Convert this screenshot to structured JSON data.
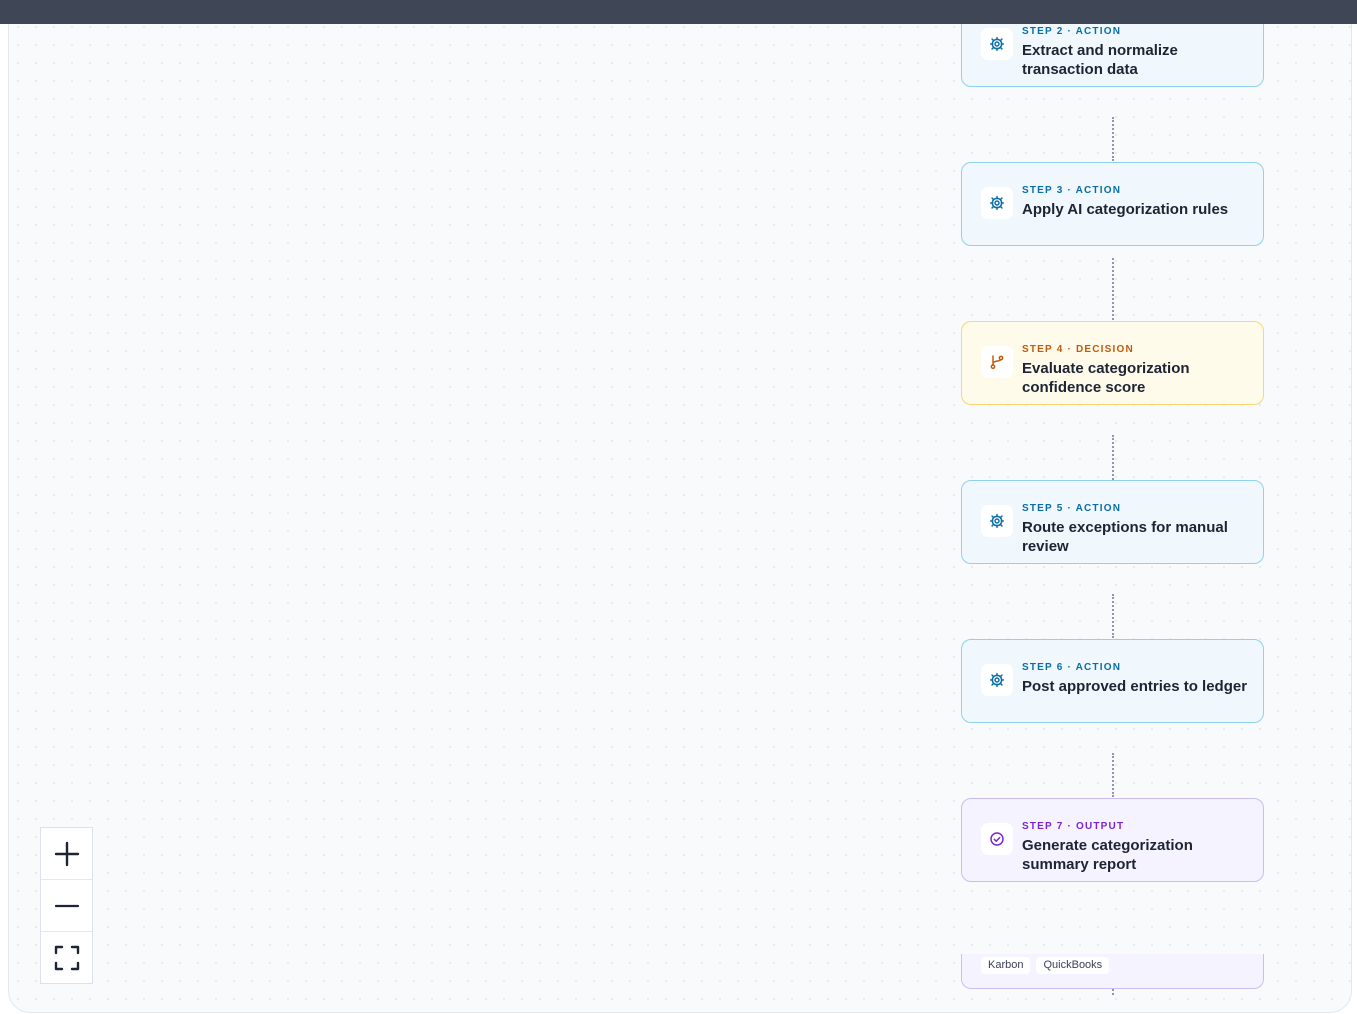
{
  "canvas": {
    "steps": [
      {
        "label": "STEP 2 · ACTION",
        "title": "Extract and normalize transaction data",
        "kind": "action",
        "icon": "gear-icon"
      },
      {
        "label": "STEP 3 · ACTION",
        "title": "Apply AI categorization rules",
        "kind": "action",
        "icon": "gear-icon"
      },
      {
        "label": "STEP 4 · DECISION",
        "title": "Evaluate categorization confidence score",
        "kind": "decision",
        "icon": "branch-icon"
      },
      {
        "label": "STEP 5 · ACTION",
        "title": "Route exceptions for manual review",
        "kind": "action",
        "icon": "gear-icon"
      },
      {
        "label": "STEP 6 · ACTION",
        "title": "Post approved entries to ledger",
        "kind": "action",
        "icon": "gear-icon"
      },
      {
        "label": "STEP 7 · OUTPUT",
        "title": "Generate categorization summary report",
        "kind": "output",
        "icon": "check-circle-icon"
      }
    ],
    "integrations": [
      "Karbon",
      "QuickBooks"
    ]
  },
  "controls": {
    "zoom_in_icon": "plus-icon",
    "zoom_out_icon": "minus-icon",
    "fit_view_icon": "fullscreen-icon"
  },
  "colors": {
    "action_accent": "#0a6ea3",
    "decision_accent": "#c2590c",
    "output_accent": "#7a25d0",
    "connector": "#8e98ac"
  }
}
